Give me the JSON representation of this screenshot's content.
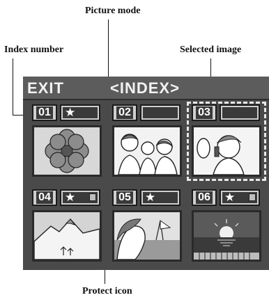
{
  "callouts": {
    "picture_mode": "Picture mode",
    "index_number": "Index number",
    "selected_image": "Selected image",
    "protect_icon": "Protect icon"
  },
  "screen": {
    "exit_label": "EXIT",
    "title": "<INDEX>"
  },
  "thumbnails": [
    {
      "number": "01",
      "mode": "★",
      "protected": false,
      "selected": false,
      "image": "flower"
    },
    {
      "number": "02",
      "mode": "",
      "protected": false,
      "selected": false,
      "image": "group-of-people"
    },
    {
      "number": "03",
      "mode": "",
      "protected": false,
      "selected": true,
      "image": "woman-on-phone"
    },
    {
      "number": "04",
      "mode": "★",
      "protected": true,
      "selected": false,
      "image": "mountain"
    },
    {
      "number": "05",
      "mode": "★",
      "protected": false,
      "selected": false,
      "image": "woman-at-beach"
    },
    {
      "number": "06",
      "mode": "★",
      "protected": true,
      "selected": false,
      "image": "sunset-over-water"
    }
  ],
  "icons": {
    "protect": "lock-icon",
    "picture_mode": "star-icon"
  }
}
